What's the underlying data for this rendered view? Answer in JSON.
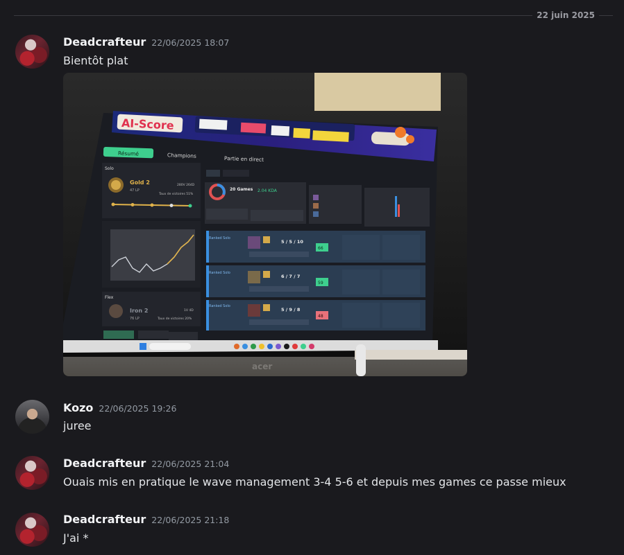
{
  "divider": {
    "date": "22 juin 2025"
  },
  "messages": [
    {
      "author": "Deadcrafteur",
      "time": "22/06/2025 18:07",
      "text": "Bientôt plat",
      "attachment": {
        "banner_title": "AI-Score",
        "tabs": [
          "Résumé",
          "Champions",
          "Partie en direct"
        ],
        "solo": {
          "label": "Solo",
          "rank": "Gold 2",
          "lp": "47 LP",
          "record": "280V 264D",
          "winrate": "Taux de victoires 51%"
        },
        "flex": {
          "label": "Flex",
          "rank": "Iron 2",
          "lp": "76 LP",
          "record": "1V 4D",
          "winrate": "Taux de victoires 20%"
        },
        "summary": {
          "games": "20 Games",
          "kda": "2.04 KDA"
        },
        "games": [
          {
            "mode": "Ranked Solo",
            "score": "5 / 5 / 10",
            "ai": "66"
          },
          {
            "mode": "Ranked Solo",
            "score": "6 / 7 / 7",
            "ai": "59"
          },
          {
            "mode": "Ranked Solo",
            "score": "5 / 9 / 8",
            "ai": "48"
          }
        ],
        "brand": "acer"
      }
    },
    {
      "author": "Kozo",
      "time": "22/06/2025 19:26",
      "text": "juree"
    },
    {
      "author": "Deadcrafteur",
      "time": "22/06/2025 21:04",
      "text": "Ouais mis en pratique le wave management 3-4  5-6 et depuis mes games ce passe mieux"
    },
    {
      "author": "Deadcrafteur",
      "time": "22/06/2025 21:18",
      "text": "J'ai *"
    }
  ]
}
